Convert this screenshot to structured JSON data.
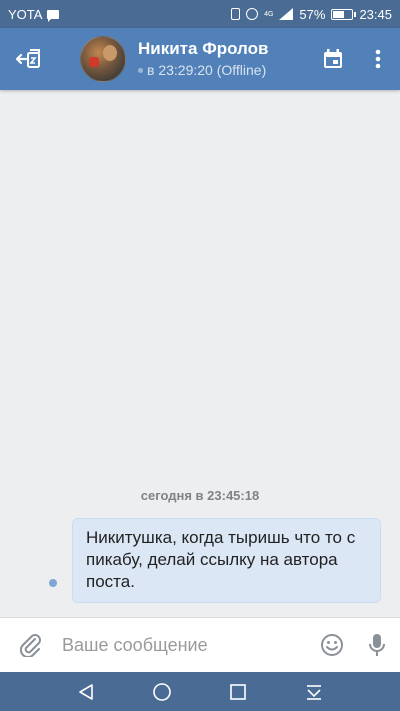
{
  "status_bar": {
    "carrier": "YOTA",
    "network": "4G",
    "battery": "57%",
    "battery_level": 0.57,
    "time": "23:45"
  },
  "header": {
    "contact_name": "Никита Фролов",
    "last_seen": "в 23:29:20 (Offline)"
  },
  "messages": {
    "date_label": "сегодня в 23:45:18",
    "items": [
      {
        "text": "Никитушка, когда тыришь что то с пикабу, делай ссылку на автора поста.",
        "outgoing": true,
        "unread": true
      }
    ]
  },
  "composer": {
    "placeholder": "Ваше сообщение",
    "value": ""
  },
  "colors": {
    "status_bar": "#4a6c94",
    "header": "#5181b8",
    "chat_background": "#edeef0",
    "bubble": "#dce7f5",
    "icon_gray": "#8a9098"
  },
  "icons": [
    "message-icon",
    "vibrate-icon",
    "alarm-icon",
    "signal-icon",
    "battery-icon",
    "back-icon",
    "calendar-icon",
    "more-vertical-icon",
    "paperclip-icon",
    "emoji-icon",
    "microphone-icon",
    "nav-back-icon",
    "nav-home-icon",
    "nav-recents-icon",
    "nav-down-icon"
  ]
}
